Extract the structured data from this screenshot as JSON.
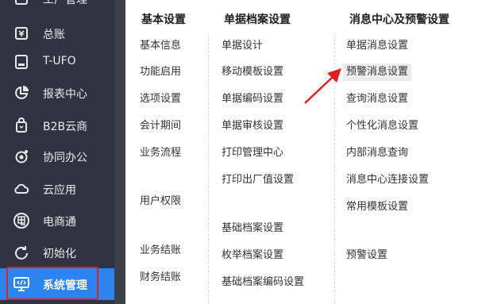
{
  "sidebar": {
    "items": [
      {
        "label": "工厂管理",
        "icon": "building-icon"
      },
      {
        "label": "总账",
        "icon": "ledger-icon"
      },
      {
        "label": "T-UFO",
        "icon": "ufo-icon"
      },
      {
        "label": "报表中心",
        "icon": "pie-chart-icon"
      },
      {
        "label": "B2B云商",
        "icon": "shopping-bag-icon"
      },
      {
        "label": "协同办公",
        "icon": "collaboration-icon"
      },
      {
        "label": "云应用",
        "icon": "cloud-icon"
      },
      {
        "label": "电商通",
        "icon": "ecommerce-icon"
      },
      {
        "label": "初始化",
        "icon": "refresh-icon"
      },
      {
        "label": "系统管理",
        "icon": "system-monitor-icon",
        "active": true
      }
    ]
  },
  "columns": {
    "col1": {
      "header": "基本设置",
      "items": [
        "基本信息",
        "功能启用",
        "选项设置",
        "会计期间",
        "业务流程",
        "用户权限",
        "业务结账",
        "财务结账"
      ]
    },
    "col2": {
      "header": "单据档案设置",
      "items": [
        "单据设计",
        "移动模板设置",
        "单据编码设置",
        "单据审核设置",
        "打印管理中心",
        "打印出厂值设置",
        "基础档案设置",
        "枚举档案设置",
        "基础档案编码设置"
      ]
    },
    "col3": {
      "header": "消息中心及预警设置",
      "items": [
        "单据消息设置",
        "预警消息设置",
        "查询消息设置",
        "个性化消息设置",
        "内部消息查询",
        "消息中心连接设置",
        "常用模板设置",
        "预警设置"
      ],
      "highlighted_index": 1
    }
  },
  "colors": {
    "sidebar_bg": "#2f3440",
    "active_item": "#2b84f0",
    "annotation_red": "#e0201c"
  }
}
